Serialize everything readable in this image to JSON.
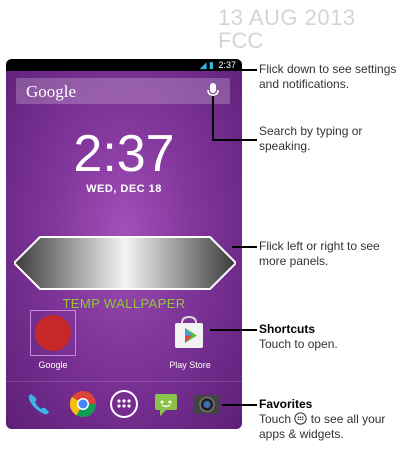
{
  "stamp": {
    "date": "13 AUG 2013",
    "code": "FCC"
  },
  "phone": {
    "status_time": "2:37",
    "search_logo": "Google",
    "clock_hours": "2",
    "clock_minutes": ":37",
    "date": "WED, DEC 18",
    "wallpaper_label": "TEMP WALLPAPER",
    "apps": [
      {
        "label": "Google",
        "icon": "google-search-icon"
      },
      {
        "label": "Play Store",
        "icon": "play-store-icon"
      }
    ],
    "dock": [
      "phone-icon",
      "chrome-icon",
      "all-apps-icon",
      "messaging-icon",
      "camera-icon"
    ]
  },
  "callouts": {
    "notifications": "Flick down to see settings and notifications.",
    "search": "Search by typing or speaking.",
    "panels": "Flick left or right to see more panels.",
    "shortcuts_title": "Shortcuts",
    "shortcuts_text": "Touch to open.",
    "favorites_title": "Favorites",
    "favorites_touch": "Touch",
    "favorites_rest": "to see all your apps & widgets."
  },
  "colors": {
    "wallpaper": "#7f3499",
    "accent_green": "#8fc93a",
    "status_blue": "#33b5e5"
  }
}
